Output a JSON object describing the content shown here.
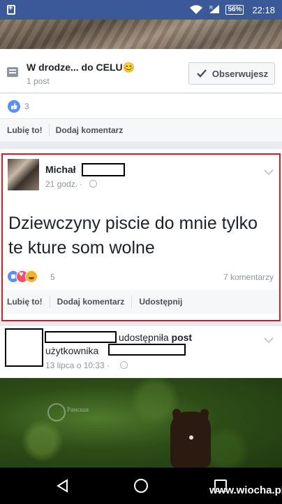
{
  "status_bar": {
    "battery": "56%",
    "time": "22:18",
    "network_letter": "R"
  },
  "group": {
    "title": "W drodze... do CELU",
    "emoji": "😊",
    "post_count": "1 post",
    "follow_label": "Obserwujesz"
  },
  "card1": {
    "like_count": "3",
    "actions": [
      "Lubię to!",
      "Dodaj komentarz"
    ]
  },
  "post": {
    "author": "Michał",
    "time": "21 godz. ·",
    "text": "Dziewczyny piscie do mnie tylko te kture som wolne",
    "reaction_count": "5",
    "comments": "7 komentarzy",
    "actions": [
      "Lubię to!",
      "Dodaj komentarz",
      "Udostępnij"
    ]
  },
  "share": {
    "shared_text": "udostępniła",
    "post_word": "post",
    "user_word": "użytkownika",
    "time": "13 lipca o 10:33 ·"
  },
  "photo": {
    "watermark": "Рамская"
  },
  "watermark_site": "www.wiocha.pl",
  "colors": {
    "facebook_blue": "#3b5998",
    "highlight_red": "#d31b27",
    "like_blue": "#5890ff"
  }
}
